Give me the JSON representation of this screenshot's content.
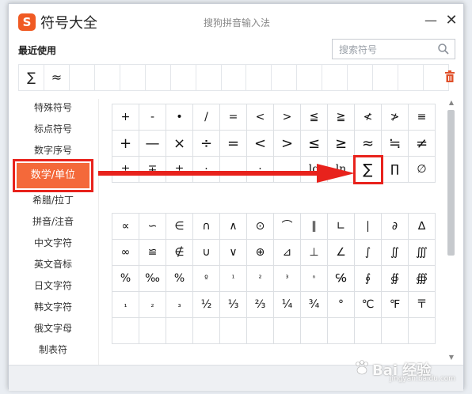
{
  "window": {
    "title": "符号大全",
    "ime_name": "搜狗拼音输入法",
    "logo_glyph": "S",
    "minimize_glyph": "—",
    "close_glyph": "✕"
  },
  "recent": {
    "label": "最近使用",
    "items": [
      "∑",
      "≈",
      "",
      "",
      "",
      "",
      "",
      "",
      "",
      "",
      "",
      "",
      "",
      "",
      "",
      "",
      ""
    ]
  },
  "search": {
    "placeholder": "搜索符号",
    "value": ""
  },
  "categories": [
    {
      "label": "特殊符号"
    },
    {
      "label": "标点符号"
    },
    {
      "label": "数字序号"
    },
    {
      "label": "数学/单位"
    },
    {
      "label": "希腊/拉丁"
    },
    {
      "label": "拼音/注音"
    },
    {
      "label": "中文字符"
    },
    {
      "label": "英文音标"
    },
    {
      "label": "日文字符"
    },
    {
      "label": "韩文字符"
    },
    {
      "label": "俄文字母"
    },
    {
      "label": "制表符"
    }
  ],
  "active_category": "数学/单位",
  "symbols_group1": [
    "+",
    "-",
    "•",
    "/",
    "=",
    "<",
    ">",
    "≦",
    "≧",
    "≮",
    "≯",
    "≡",
    "+",
    "—",
    "×",
    "÷",
    "=",
    "<",
    ">",
    "≤",
    "≥",
    "≈",
    "≒",
    "≠",
    "±",
    "∓",
    "±",
    "·",
    "‥",
    "·",
    "‥",
    "lg",
    "ln",
    "∑",
    "∏",
    "∅"
  ],
  "symbols_group2": [
    "∝",
    "∽",
    "∈",
    "∩",
    "∧",
    "⊙",
    "⌒",
    "∥",
    "∟",
    "∣",
    "∂",
    "∆",
    "∞",
    "≌",
    "∉",
    "∪",
    "∨",
    "⊕",
    "⊿",
    "⊥",
    "∠",
    "∫",
    "∬",
    "∭",
    "%",
    "‰",
    "%",
    "º",
    "¹",
    "²",
    "³",
    "ⁿ",
    "℅",
    "∮",
    "∯",
    "∰",
    "₁",
    "₂",
    "₃",
    "½",
    "⅓",
    "⅔",
    "¼",
    "¾",
    "°",
    "℃",
    "℉",
    "〒",
    "",
    "",
    "",
    "",
    "",
    "",
    "",
    "",
    "",
    "",
    "",
    ""
  ],
  "highlighted_symbol": "∑",
  "colors": {
    "accent": "#f4693a",
    "highlight": "#e8221c",
    "logo": "#f05a23"
  },
  "watermark": {
    "text": "Bai 经验",
    "sub": "jingyan.baidu.com"
  }
}
